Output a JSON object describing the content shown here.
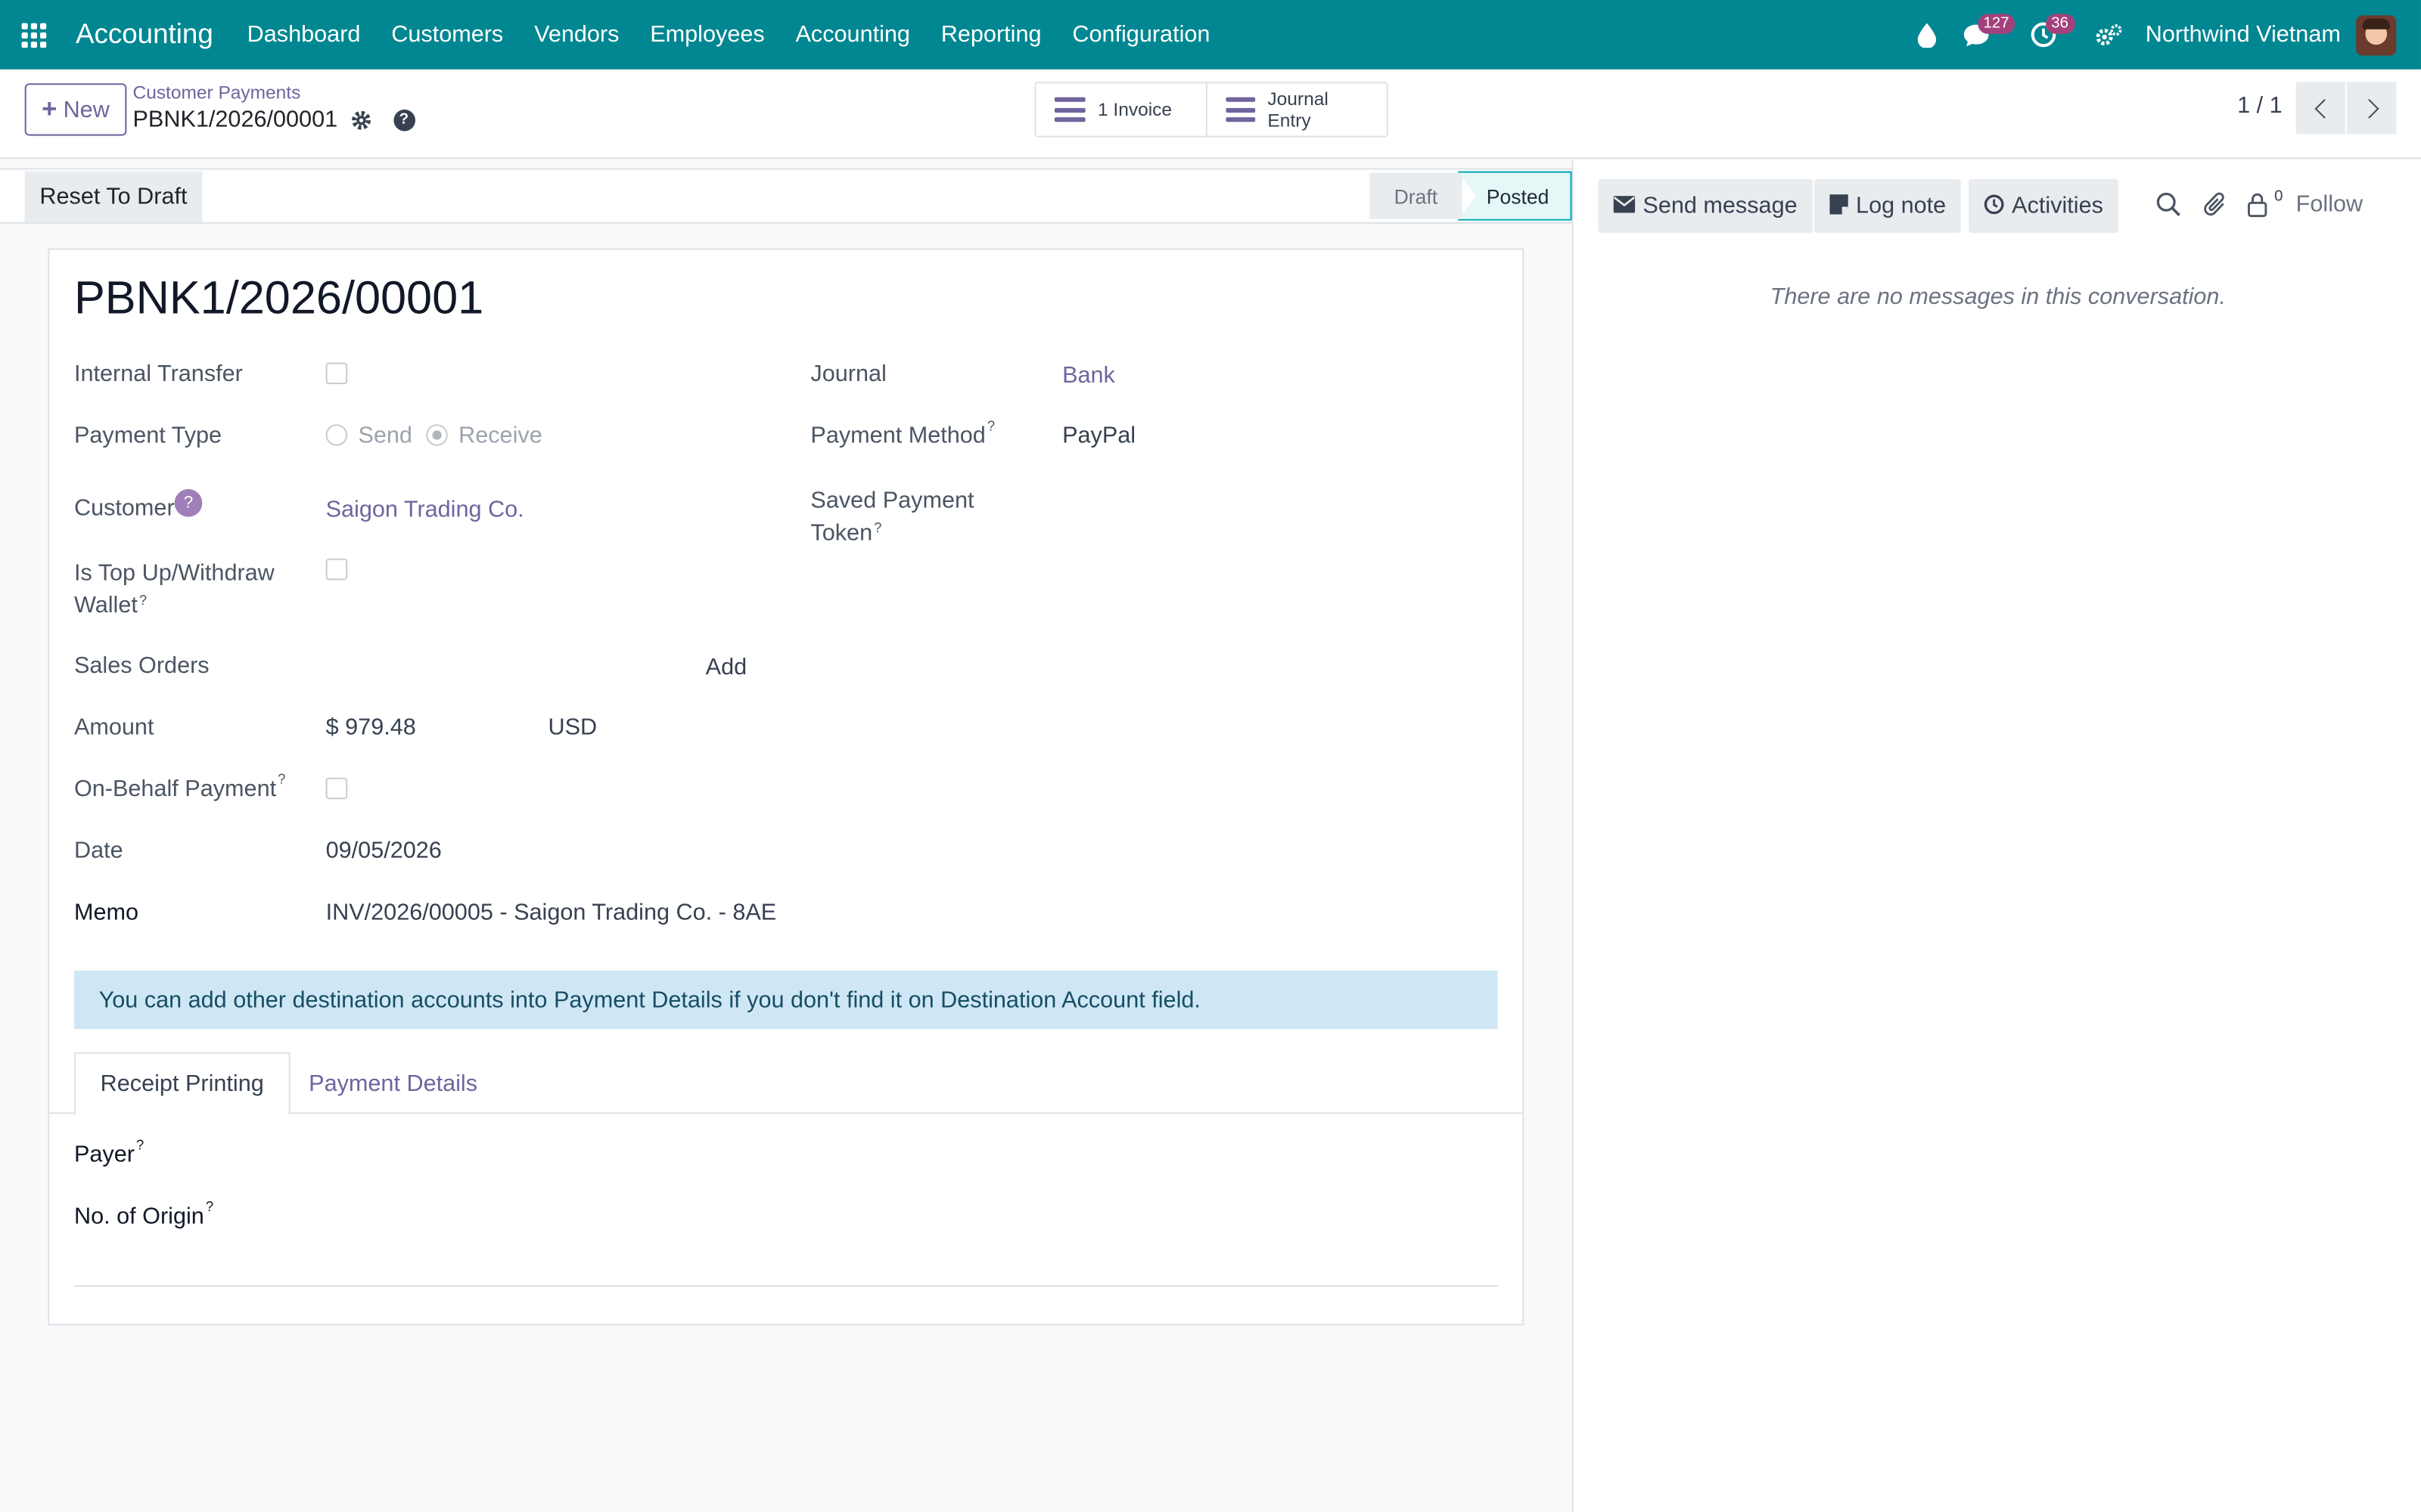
{
  "navbar": {
    "app_title": "Accounting",
    "menu": [
      "Dashboard",
      "Customers",
      "Vendors",
      "Employees",
      "Accounting",
      "Reporting",
      "Configuration"
    ],
    "messages_count": "127",
    "activities_count": "36",
    "company": "Northwind Vietnam"
  },
  "control": {
    "new_label": "New",
    "breadcrumb": "Customer Payments",
    "record_name": "PBNK1/2026/00001",
    "smart_buttons": [
      "1 Invoice",
      "Journal Entry"
    ],
    "pager": "1 / 1"
  },
  "statusbar": {
    "reset_label": "Reset To Draft",
    "stages": [
      "Draft",
      "Posted"
    ],
    "current_stage": "Posted"
  },
  "chatter": {
    "send_message": "Send message",
    "log_note": "Log note",
    "activities": "Activities",
    "follower_count": "0",
    "follow": "Follow",
    "empty": "There are no messages in this conversation."
  },
  "form": {
    "title": "PBNK1/2026/00001",
    "internal_transfer_label": "Internal Transfer",
    "payment_type_label": "Payment Type",
    "payment_type_send": "Send",
    "payment_type_receive": "Receive",
    "customer_label": "Customer",
    "customer_value": "Saigon Trading Co.",
    "top_up_label": "Is Top Up/Withdraw",
    "top_up_label2": "Wallet",
    "sales_orders_label": "Sales Orders",
    "sales_orders_add": "Add",
    "amount_label": "Amount",
    "amount_value": "$ 979.48",
    "currency": "USD",
    "on_behalf_label": "On-Behalf Payment",
    "date_label": "Date",
    "date_value": "09/05/2026",
    "memo_label": "Memo",
    "memo_value": "INV/2026/00005 - Saigon Trading Co. - 8AE",
    "journal_label": "Journal",
    "journal_value": "Bank",
    "payment_method_label": "Payment Method",
    "payment_method_value": "PayPal",
    "saved_token_label": "Saved Payment",
    "saved_token_label2": "Token",
    "alert": "You can add other destination accounts into Payment Details if you don't find it on Destination Account field.",
    "tabs": [
      "Receipt Printing",
      "Payment Details"
    ],
    "payer_label": "Payer",
    "origin_label": "No. of Origin"
  }
}
